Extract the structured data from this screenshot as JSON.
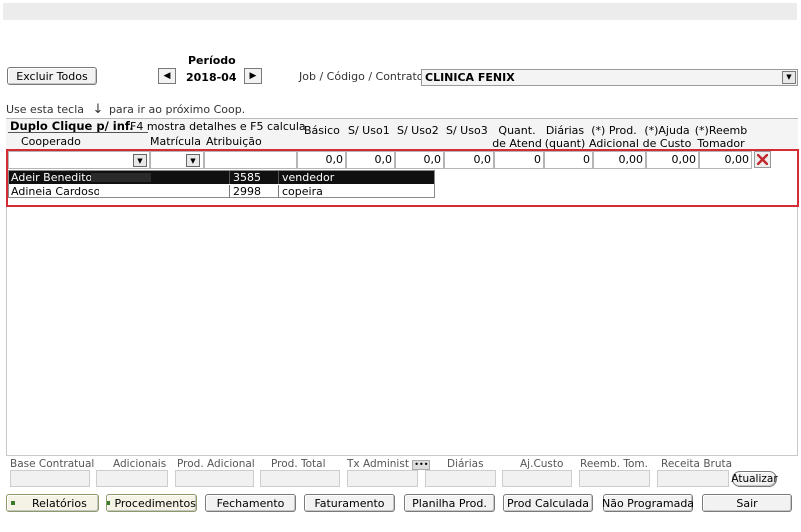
{
  "toolbar": {
    "excluir_todos": "Excluir Todos",
    "periodo_label": "Período",
    "periodo_value": "2018-04",
    "job_label": "Job / Código / Contrato:",
    "job_value": "CLINICA FENIX"
  },
  "hint": {
    "text_before": "Use esta tecla",
    "arrow": "↓",
    "text_after": "para ir ao próximo Coop."
  },
  "grid": {
    "title": "Duplo Clique p/ inf.",
    "subtitle": "F4 mostra detalhes e F5 calcula",
    "col_cooperado": "Cooperado",
    "col_matricula": "Matrícula",
    "col_atribuicao": "Atribuição",
    "col_basico": "Básico",
    "col_uso1": "S/ Uso1",
    "col_uso2": "S/ Uso2",
    "col_uso3": "S/ Uso3",
    "col_quant_1": "Quant.",
    "col_quant_2": "de Atend",
    "col_diarias_1": "Diárias",
    "col_diarias_2": "(quant)",
    "col_prod_1": "(*) Prod.",
    "col_prod_2": "Adicional",
    "col_ajuda_1": "(*)Ajuda",
    "col_ajuda_2": "de Custo",
    "col_reemb_1": "(*)Reemb",
    "col_reemb_2": "Tomador"
  },
  "entry": {
    "basico": "0,0",
    "uso1": "0,0",
    "uso2": "0,0",
    "uso3": "0,0",
    "quant": "0",
    "diarias": "0",
    "prod": "0,00",
    "ajuda": "0,00",
    "reemb": "0,00",
    "delete_icon": "red-x-icon"
  },
  "dropdown": {
    "rows": [
      {
        "name": "Adeir Benedito",
        "matricula": "3585",
        "atribuicao": "vendedor",
        "selected": true
      },
      {
        "name": "Adineia Cardoso",
        "matricula": "2998",
        "atribuicao": "copeira",
        "selected": false
      }
    ]
  },
  "summary": {
    "base_contratual": "Base Contratual",
    "adicionais": "Adicionais",
    "prod_adicional": "Prod. Adicional",
    "prod_total": "Prod. Total",
    "tx_administ": "Tx Administ",
    "diarias": "Diárias",
    "aj_custo": "Aj.Custo",
    "reemb_tom": "Reemb. Tom.",
    "receita_bruta": "Receita Bruta",
    "atualizar": "Atualizar"
  },
  "bottom": {
    "relatorios": "Relatórios",
    "procedimentos": "Procedimentos",
    "fechamento": "Fechamento",
    "faturamento": "Faturamento",
    "planilha_prod": "Planilha Prod.",
    "prod_calculada": "Prod Calculada",
    "nao_programada": "Não Programada",
    "sair": "Sair"
  },
  "colors": {
    "highlight_border": "#d42b35",
    "selected_row_bg": "#101010",
    "delete_x": "#c0282e"
  }
}
